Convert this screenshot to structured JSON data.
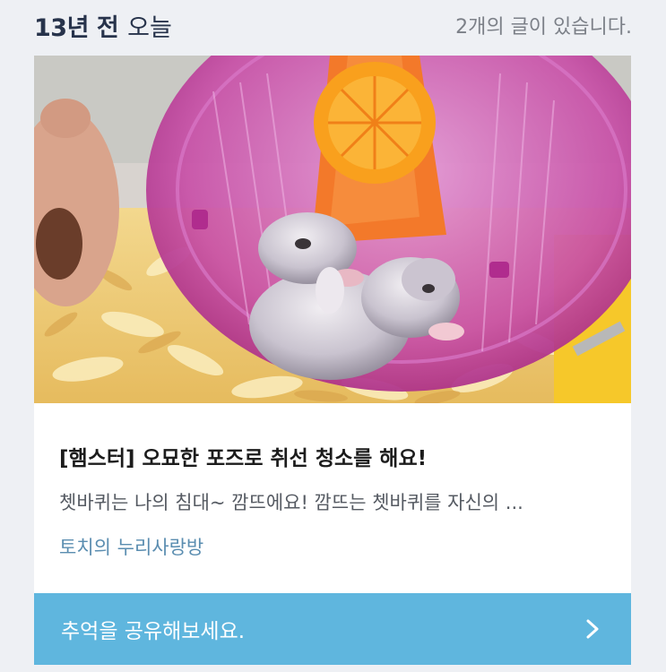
{
  "header": {
    "years_ago": "13년 전",
    "today": "오늘",
    "post_count": "2개의 글이 있습니다."
  },
  "post": {
    "title": "[햄스터] 오묘한 포즈로 취선 청소를 해요!",
    "excerpt": "쳇바퀴는 나의 침대~ 깜뜨에요! 깜뜨는 쳇바퀴를 자신의 ...",
    "blog_name": "토치의 누리사랑방",
    "image_icon": "hamster-in-wheel-photo"
  },
  "share": {
    "label": "추억을 공유해보세요.",
    "icon": "chevron-right-icon"
  },
  "colors": {
    "share_bar": "#5fb6de",
    "heading": "#27334b",
    "blog_name": "#5a8db0"
  }
}
